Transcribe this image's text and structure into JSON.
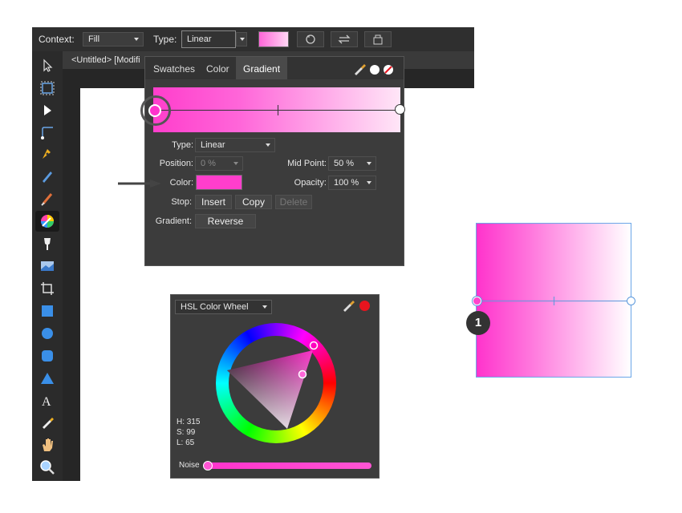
{
  "toolbar": {
    "context_label": "Context:",
    "context_value": "Fill",
    "type_label": "Type:",
    "type_value": "Linear",
    "swatch_color": "#ff7fdf"
  },
  "document": {
    "title": "<Untitled> [Modifi"
  },
  "gradient_panel": {
    "tabs": [
      "Swatches",
      "Color",
      "Gradient"
    ],
    "active_tab": "Gradient",
    "type_label": "Type:",
    "type_value": "Linear",
    "position_label": "Position:",
    "position_value": "0 %",
    "midpoint_label": "Mid Point:",
    "midpoint_value": "50 %",
    "color_label": "Color:",
    "color_value": "#ff3ecc",
    "opacity_label": "Opacity:",
    "opacity_value": "100 %",
    "stop_label": "Stop:",
    "insert_label": "Insert",
    "copy_label": "Copy",
    "delete_label": "Delete",
    "gradient_label": "Gradient:",
    "reverse_label": "Reverse",
    "gradient_start": "#ff3ecc",
    "gradient_end": "#ffffff"
  },
  "color_panel": {
    "mode_value": "HSL Color Wheel",
    "h_label": "H: 315",
    "s_label": "S: 99",
    "l_label": "L: 65",
    "noise_label": "Noise",
    "current_color": "#e8141e"
  },
  "callout": {
    "number": "1"
  }
}
